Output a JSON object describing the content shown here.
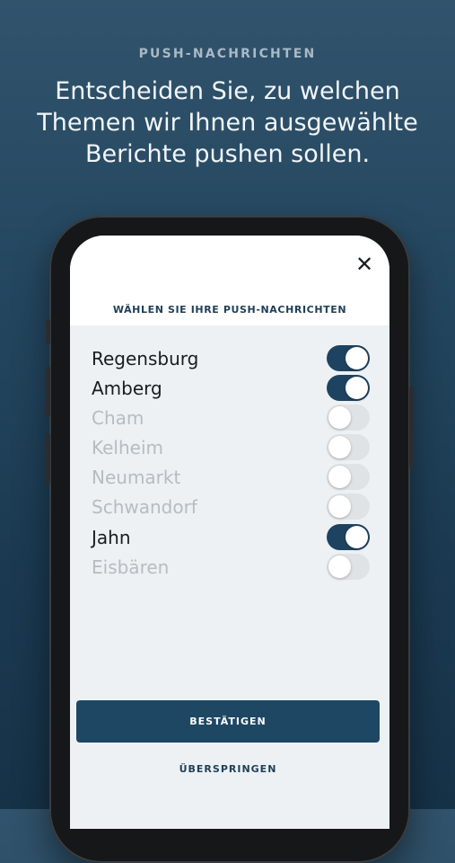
{
  "intro": {
    "eyebrow": "PUSH-NACHRICHTEN",
    "headline": "Entscheiden Sie, zu welchen Themen wir Ihnen ausgewählte Berichte pushen sollen."
  },
  "dialog": {
    "close_glyph": "✕",
    "title": "WÄHLEN SIE IHRE PUSH-NACHRICHTEN",
    "topics": [
      {
        "label": "Regensburg",
        "enabled": true
      },
      {
        "label": "Amberg",
        "enabled": true
      },
      {
        "label": "Cham",
        "enabled": false
      },
      {
        "label": "Kelheim",
        "enabled": false
      },
      {
        "label": "Neumarkt",
        "enabled": false
      },
      {
        "label": "Schwandorf",
        "enabled": false
      },
      {
        "label": "Jahn",
        "enabled": true
      },
      {
        "label": "Eisbären",
        "enabled": false
      }
    ],
    "confirm_label": "BESTÄTIGEN",
    "skip_label": "ÜBERSPRINGEN"
  },
  "colors": {
    "accent": "#1e4360",
    "background": "#244760",
    "toggle_off": "#dfe3e6"
  }
}
